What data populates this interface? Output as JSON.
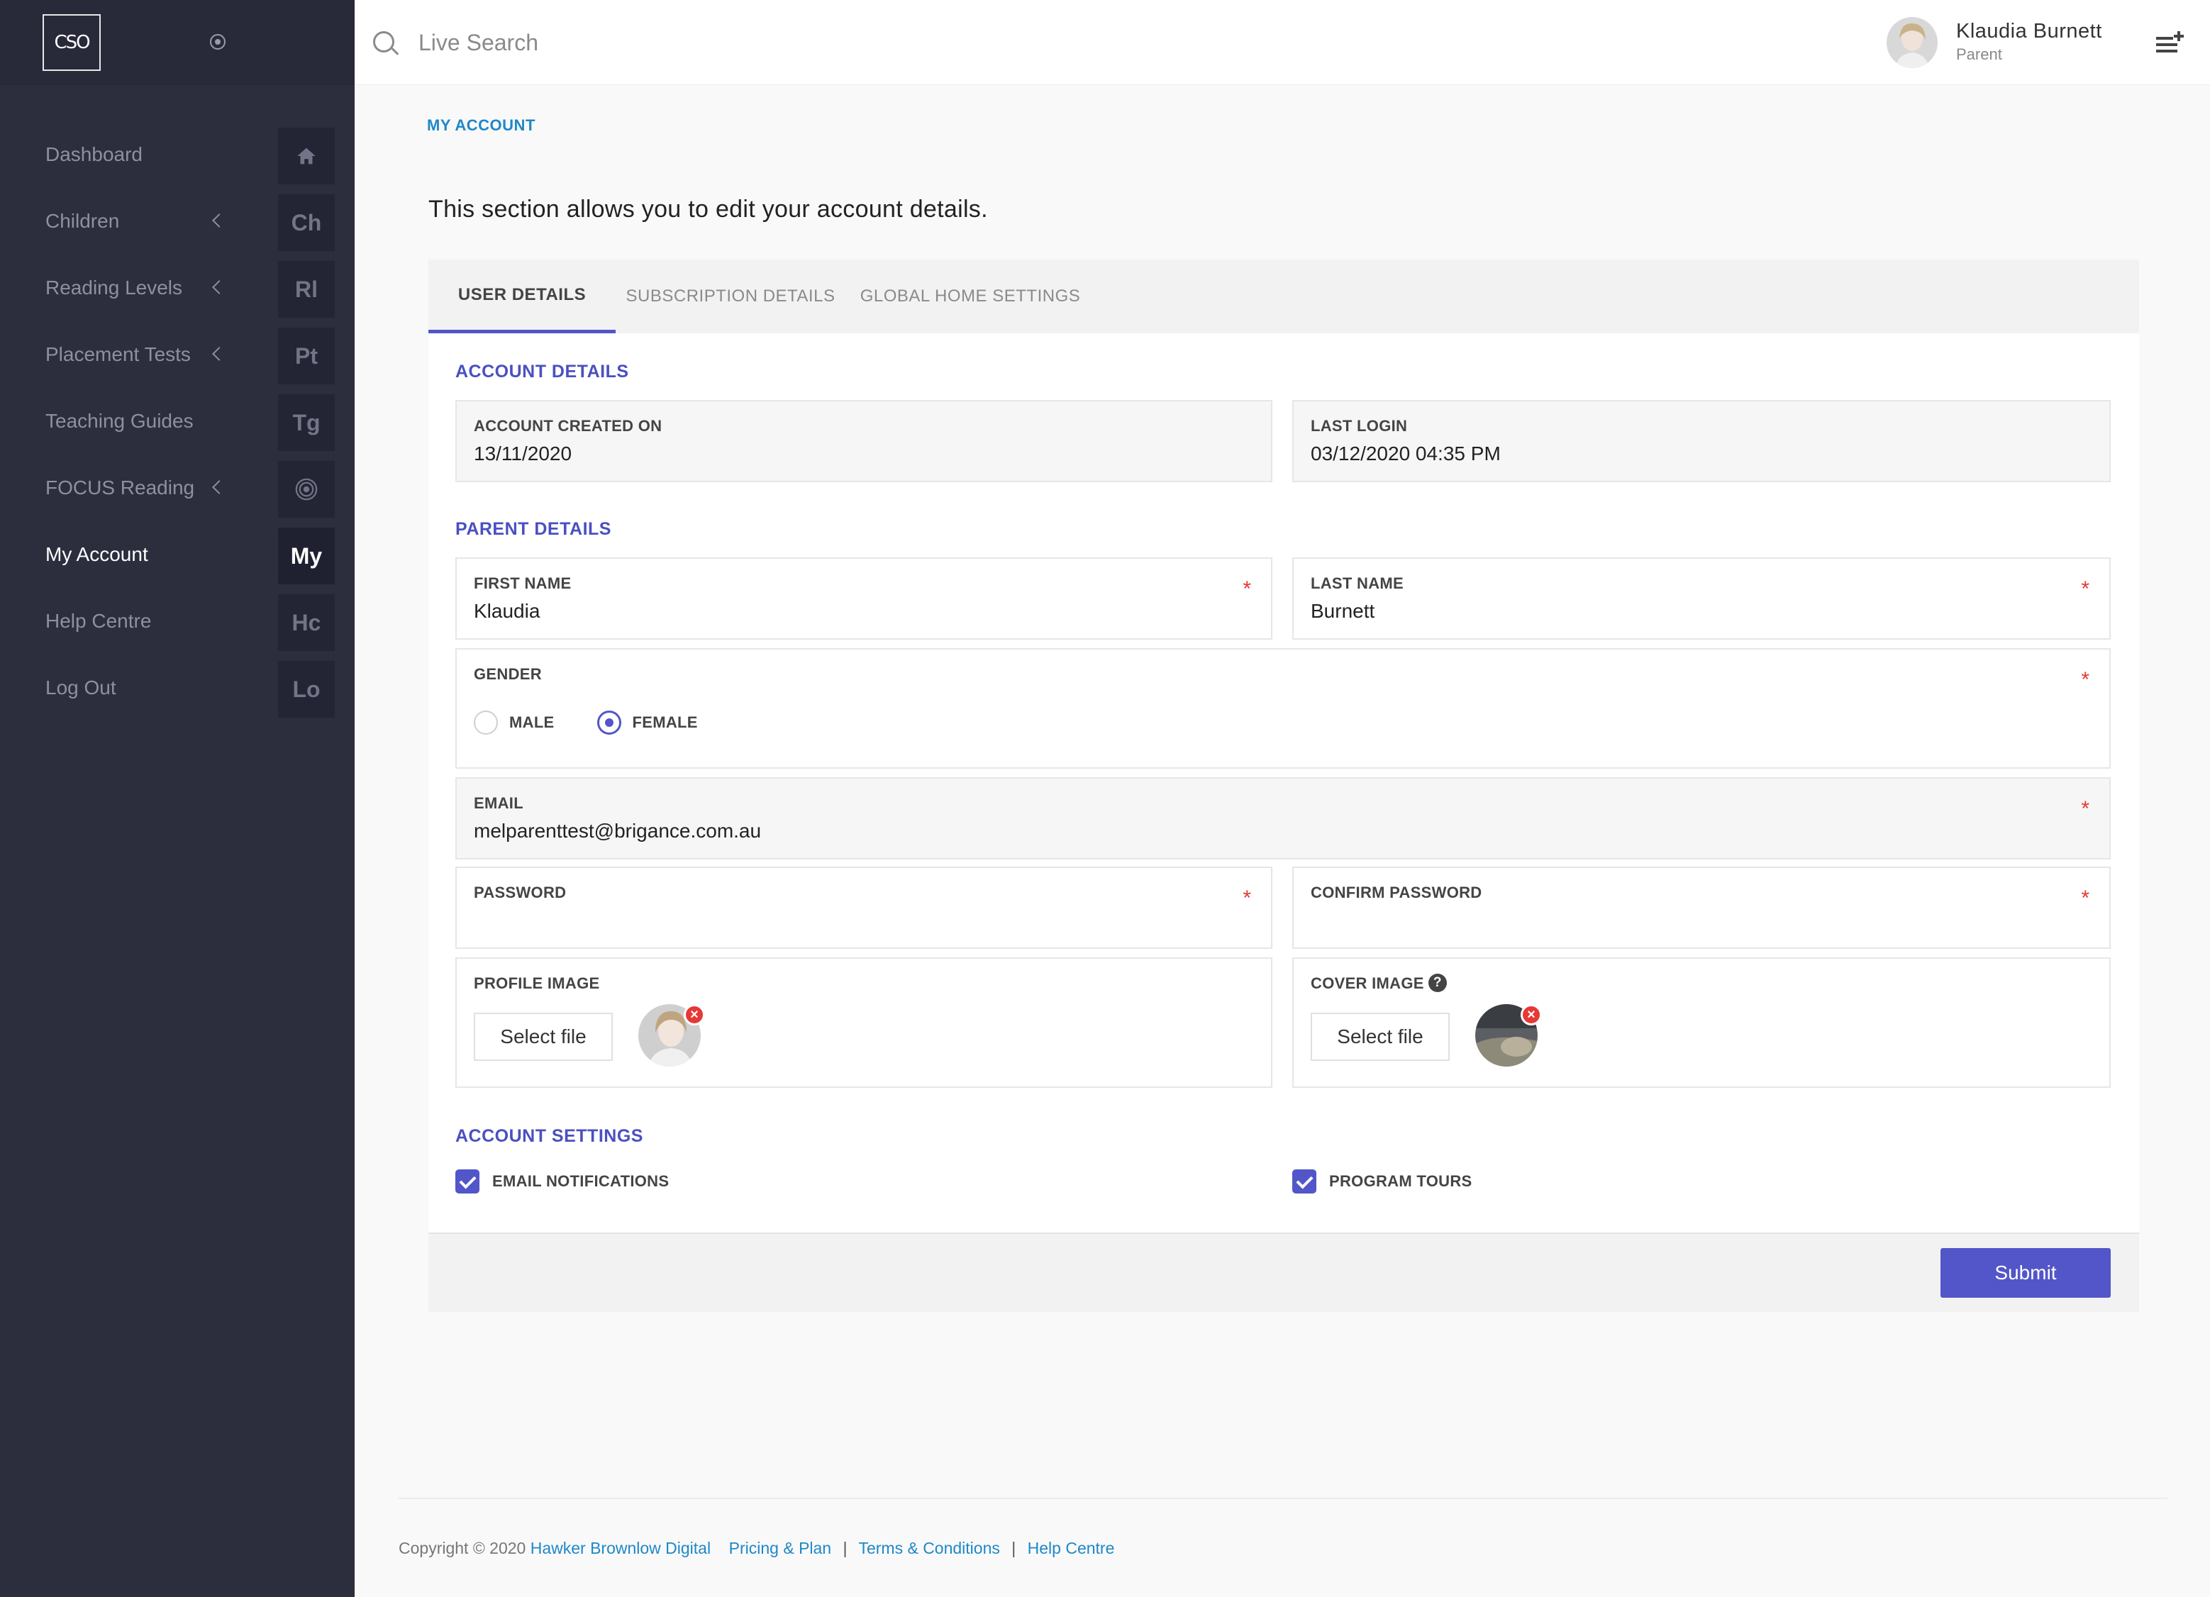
{
  "sidebar": {
    "logo_text": "CSO",
    "items": [
      {
        "label": "Dashboard",
        "badge": "",
        "icon": "home-icon",
        "chevron": false,
        "active": false
      },
      {
        "label": "Children",
        "badge": "Ch",
        "chevron": true,
        "active": false
      },
      {
        "label": "Reading Levels",
        "badge": "Rl",
        "chevron": true,
        "active": false
      },
      {
        "label": "Placement Tests",
        "badge": "Pt",
        "chevron": true,
        "active": false
      },
      {
        "label": "Teaching Guides",
        "badge": "Tg",
        "chevron": false,
        "active": false
      },
      {
        "label": "FOCUS Reading",
        "badge": "",
        "icon": "target-icon",
        "chevron": true,
        "active": false
      },
      {
        "label": "My Account",
        "badge": "My",
        "chevron": false,
        "active": true
      },
      {
        "label": "Help Centre",
        "badge": "Hc",
        "chevron": false,
        "active": false
      },
      {
        "label": "Log Out",
        "badge": "Lo",
        "chevron": false,
        "active": false
      }
    ]
  },
  "header": {
    "search_placeholder": "Live Search",
    "user_name": "Klaudia Burnett",
    "user_role": "Parent"
  },
  "page": {
    "breadcrumb": "MY ACCOUNT",
    "intro": "This section allows you to edit your account details."
  },
  "tabs": [
    {
      "label": "USER DETAILS",
      "active": true
    },
    {
      "label": "SUBSCRIPTION DETAILS",
      "active": false
    },
    {
      "label": "GLOBAL HOME SETTINGS",
      "active": false
    }
  ],
  "account_details": {
    "title": "ACCOUNT DETAILS",
    "created_label": "ACCOUNT CREATED ON",
    "created_value": "13/11/2020",
    "last_login_label": "LAST LOGIN",
    "last_login_value": "03/12/2020 04:35 PM"
  },
  "parent_details": {
    "title": "PARENT DETAILS",
    "first_name_label": "FIRST NAME",
    "first_name_value": "Klaudia",
    "last_name_label": "LAST NAME",
    "last_name_value": "Burnett",
    "gender_label": "GENDER",
    "gender_options": [
      "MALE",
      "FEMALE"
    ],
    "gender_selected": "FEMALE",
    "email_label": "EMAIL",
    "email_value": "melparenttest@brigance.com.au",
    "password_label": "PASSWORD",
    "confirm_password_label": "CONFIRM PASSWORD",
    "profile_image_label": "PROFILE IMAGE",
    "cover_image_label": "COVER IMAGE",
    "select_file_label": "Select file",
    "required_mark": "*"
  },
  "account_settings": {
    "title": "ACCOUNT SETTINGS",
    "email_notifications": "EMAIL NOTIFICATIONS",
    "program_tours": "PROGRAM TOURS"
  },
  "submit_label": "Submit",
  "footer": {
    "copyright": "Copyright © 2020",
    "company": "Hawker Brownlow Digital",
    "links": [
      "Pricing & Plan",
      "Terms & Conditions",
      "Help Centre"
    ],
    "separator": "|"
  },
  "colors": {
    "sidebar_bg": "#2c2e3e",
    "accent": "#5256c8",
    "link": "#1e88c8",
    "required": "#e53935"
  }
}
